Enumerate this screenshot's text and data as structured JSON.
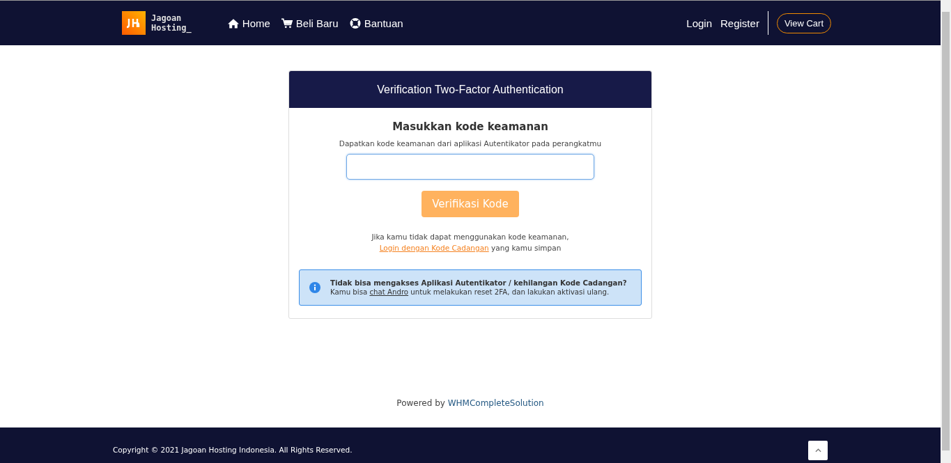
{
  "header": {
    "logo": {
      "text_line1": "Jagoan",
      "text_line2": "Hosting_"
    },
    "nav": [
      {
        "label": "Home",
        "kind": "home"
      },
      {
        "label": "Beli Baru",
        "kind": "shop"
      },
      {
        "label": "Bantuan",
        "kind": "help"
      }
    ],
    "account_links": [
      "Login",
      "Register"
    ],
    "cart_button": "View Cart"
  },
  "card": {
    "title": "Verification Two-Factor Authentication",
    "heading": "Masukkan kode keamanan",
    "subtitle": "Dapatkan kode keamanan dari aplikasi Autentikator pada perangkatmu",
    "code_field": {
      "focused": true
    },
    "submit_button": {
      "label": "Verifikasi Kode",
      "disabled": true
    },
    "fallback": {
      "line1": "Jika kamu tidak dapat menggunakan kode keamanan,",
      "link": "Login dengan Kode Cadangan",
      "rest": "yang kamu simpan"
    },
    "alert": {
      "title": "Tidak bisa mengakses Aplikasi Autentikator / kehilangan Kode Cadangan?",
      "before": "Kamu bisa",
      "link": "chat Andro",
      "after": "untuk melakukan reset 2FA, dan lakukan aktivasi ulang."
    }
  },
  "powered": {
    "prefix": "Powered by",
    "link": "WHMCompleteSolution"
  },
  "footer": {
    "copyright": "Copyright © 2021 Jagoan Hosting Indonesia. All Rights Reserved."
  }
}
